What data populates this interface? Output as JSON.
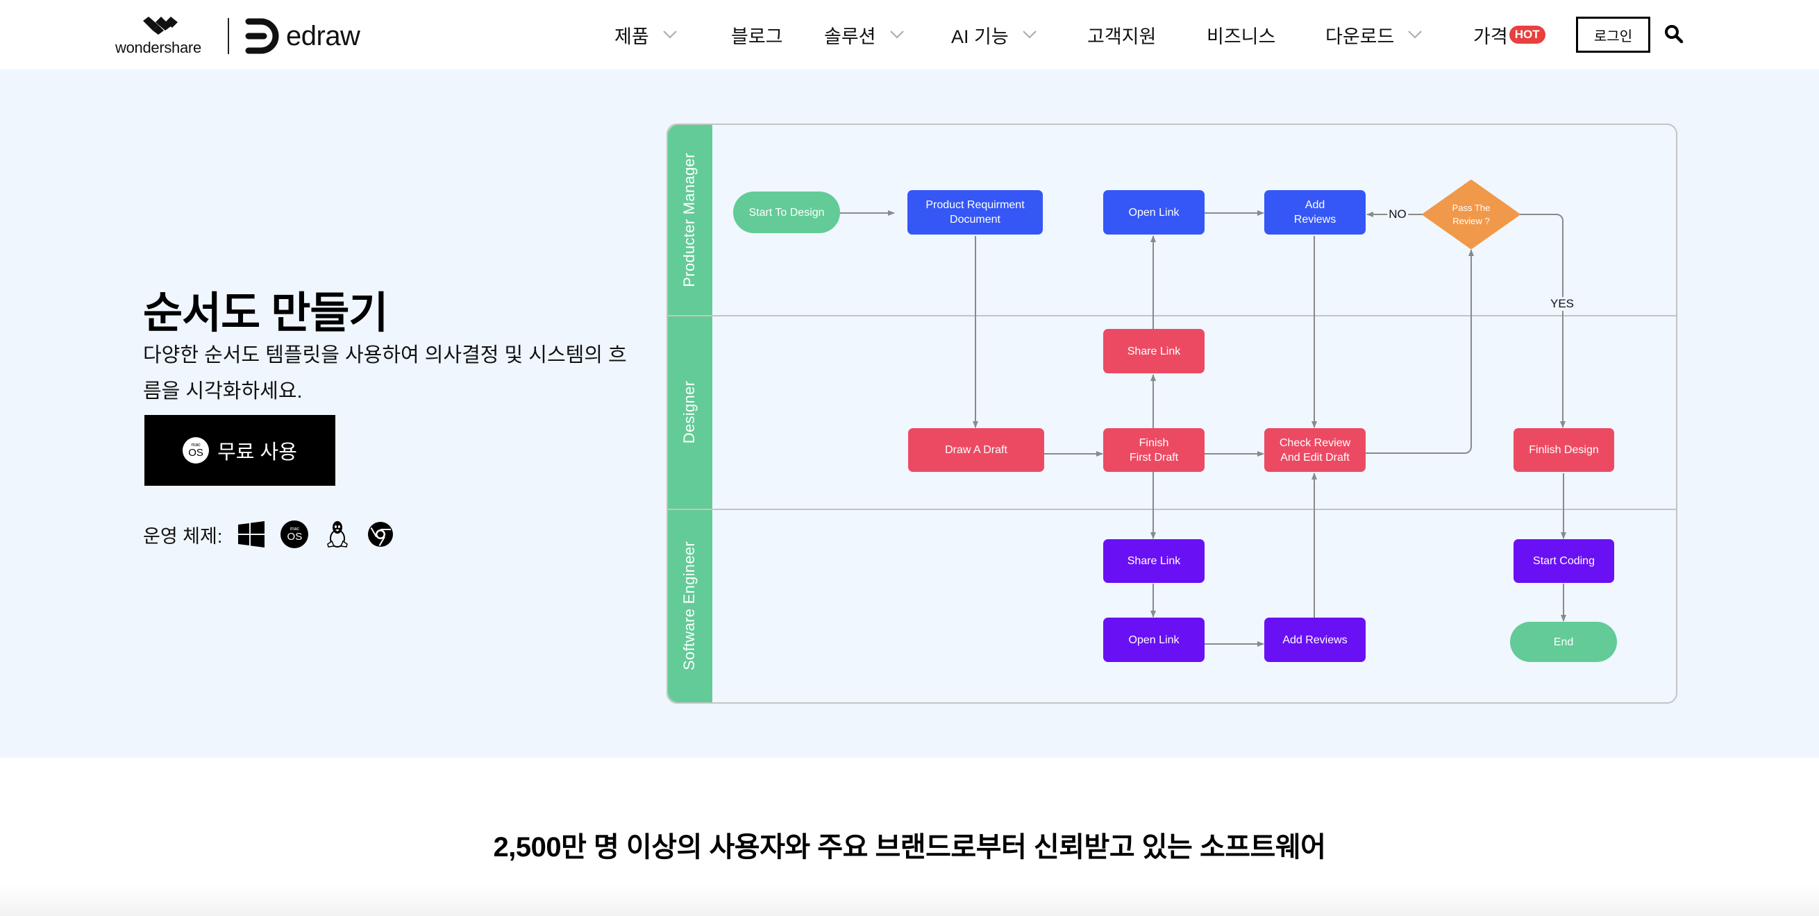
{
  "header": {
    "brand_parent": "wondershare",
    "brand_product": "edraw",
    "nav": [
      {
        "label": "제품",
        "has_dropdown": true
      },
      {
        "label": "블로그",
        "has_dropdown": false
      },
      {
        "label": "솔루션",
        "has_dropdown": true
      },
      {
        "label": "AI 기능",
        "has_dropdown": true
      },
      {
        "label": "고객지원",
        "has_dropdown": false
      },
      {
        "label": "비즈니스",
        "has_dropdown": false
      },
      {
        "label": "다운로드",
        "has_dropdown": true
      },
      {
        "label": "가격",
        "has_dropdown": false,
        "badge": "HOT"
      }
    ],
    "login_label": "로그인",
    "search_icon": "search-icon"
  },
  "hero": {
    "title": "순서도 만들기",
    "description": "다양한 순서도 템플릿을 사용하여 의사결정 및 시스템의 흐름을 시각화하세요.",
    "cta": {
      "label": "무료 사용",
      "icon_top": "mac",
      "icon_bottom": "OS"
    },
    "os_label": "운영 체제:",
    "os_icons": [
      "windows-icon",
      "macos-icon",
      "linux-icon",
      "chrome-icon"
    ],
    "os_mac_top": "mac",
    "os_mac_bottom": "OS"
  },
  "flowchart": {
    "lanes": [
      "Producter Manager",
      "Designer",
      "Software Engineer"
    ],
    "nodes": [
      {
        "id": "start",
        "label": "Start To Design",
        "lane": 0,
        "shape": "terminal",
        "color": "green"
      },
      {
        "id": "prd",
        "label": "Product Requirment\nDocument",
        "lane": 0,
        "shape": "process",
        "color": "blue"
      },
      {
        "id": "pm_open",
        "label": "Open Link",
        "lane": 0,
        "shape": "process",
        "color": "blue"
      },
      {
        "id": "pm_add",
        "label": "Add\nReviews",
        "lane": 0,
        "shape": "process",
        "color": "blue"
      },
      {
        "id": "decision",
        "label": "Pass The\nReview ?",
        "lane": 0,
        "shape": "decision",
        "color": "orange"
      },
      {
        "id": "d_share",
        "label": "Share Link",
        "lane": 1,
        "shape": "process",
        "color": "red"
      },
      {
        "id": "draft",
        "label": "Draw A Draft",
        "lane": 1,
        "shape": "process",
        "color": "red"
      },
      {
        "id": "finish_first",
        "label": "Finish\nFirst Draft",
        "lane": 1,
        "shape": "process",
        "color": "red"
      },
      {
        "id": "check",
        "label": "Check Review\nAnd Edit Draft",
        "lane": 1,
        "shape": "process",
        "color": "red"
      },
      {
        "id": "finish_design",
        "label": "Finlish Design",
        "lane": 1,
        "shape": "process",
        "color": "red"
      },
      {
        "id": "se_share",
        "label": "Share Link",
        "lane": 2,
        "shape": "process",
        "color": "purple"
      },
      {
        "id": "se_open",
        "label": "Open Link",
        "lane": 2,
        "shape": "process",
        "color": "purple"
      },
      {
        "id": "se_add",
        "label": "Add Reviews",
        "lane": 2,
        "shape": "process",
        "color": "purple"
      },
      {
        "id": "coding",
        "label": "Start Coding",
        "lane": 2,
        "shape": "process",
        "color": "purple"
      },
      {
        "id": "end",
        "label": "End",
        "lane": 2,
        "shape": "terminal",
        "color": "green"
      }
    ],
    "edges": [
      {
        "from": "start",
        "to": "prd"
      },
      {
        "from": "prd",
        "to": "draft"
      },
      {
        "from": "draft",
        "to": "finish_first"
      },
      {
        "from": "finish_first",
        "to": "d_share"
      },
      {
        "from": "d_share",
        "to": "pm_open"
      },
      {
        "from": "pm_open",
        "to": "pm_add"
      },
      {
        "from": "pm_add",
        "to": "check"
      },
      {
        "from": "finish_first",
        "to": "check"
      },
      {
        "from": "finish_first",
        "to": "se_share"
      },
      {
        "from": "se_share",
        "to": "se_open"
      },
      {
        "from": "se_open",
        "to": "se_add"
      },
      {
        "from": "se_add",
        "to": "check"
      },
      {
        "from": "check",
        "to": "decision"
      },
      {
        "from": "decision",
        "to": "pm_add",
        "label": "NO"
      },
      {
        "from": "decision",
        "to": "finish_design",
        "label": "YES"
      },
      {
        "from": "finish_design",
        "to": "coding"
      },
      {
        "from": "coding",
        "to": "end"
      }
    ],
    "colors": {
      "lane_header": "#63cb97",
      "blue": "#3557f6",
      "red": "#ec4a63",
      "purple": "#6a10f5",
      "green": "#63cb97",
      "orange": "#f0994a",
      "connector": "#8a8a8a",
      "frame": "#c4c4c4"
    }
  },
  "trust": {
    "title": "2,500만 명 이상의 사용자와 주요 브랜드로부터 신뢰받고 있는 소프트웨어"
  },
  "theme": {
    "hero_bg": "#eff6fe",
    "hot_badge": "#e8403f"
  }
}
